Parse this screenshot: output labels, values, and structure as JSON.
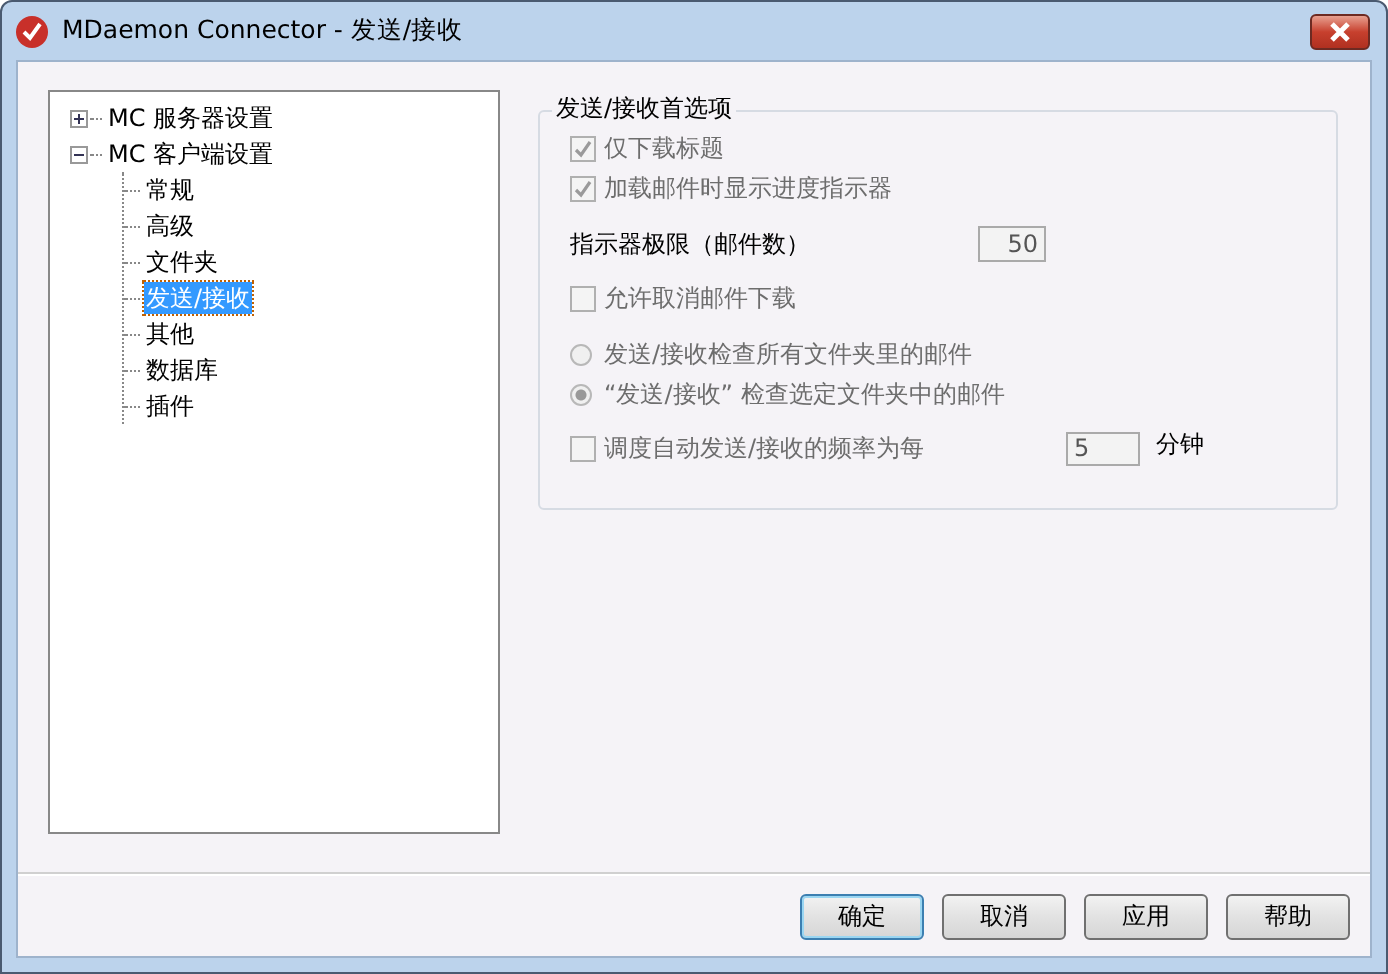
{
  "window": {
    "title": "MDaemon Connector - 发送/接收"
  },
  "tree": [
    {
      "label": "MC 服务器设置",
      "expanded": false,
      "selected": false
    },
    {
      "label": "MC 客户端设置",
      "expanded": true,
      "selected": false,
      "children": [
        {
          "label": "常规",
          "selected": false
        },
        {
          "label": "高级",
          "selected": false
        },
        {
          "label": "文件夹",
          "selected": false
        },
        {
          "label": "发送/接收",
          "selected": true
        },
        {
          "label": "其他",
          "selected": false
        },
        {
          "label": "数据库",
          "selected": false
        },
        {
          "label": "插件",
          "selected": false
        }
      ]
    }
  ],
  "group": {
    "title": "发送/接收首选项",
    "options": [
      {
        "kind": "checkbox",
        "label": "仅下载标题",
        "checked": true,
        "disabled": true
      },
      {
        "kind": "checkbox",
        "label": "加载邮件时显示进度指示器",
        "checked": true,
        "disabled": true
      },
      {
        "kind": "number",
        "label": "指示器极限（邮件数）",
        "value": "50",
        "disabled": true
      },
      {
        "kind": "checkbox",
        "label": "允许取消邮件下载",
        "checked": false,
        "disabled": true
      },
      {
        "kind": "radio",
        "label": "发送/接收检查所有文件夹里的邮件",
        "selected": false,
        "disabled": true
      },
      {
        "kind": "radio",
        "label": "“发送/接收” 检查选定文件夹中的邮件",
        "selected": true,
        "disabled": true
      },
      {
        "kind": "schedule",
        "label": "调度自动发送/接收的频率为每",
        "checked": false,
        "value": "5",
        "unit": "分钟",
        "disabled": true
      }
    ]
  },
  "buttons": [
    {
      "label": "确定",
      "default": true
    },
    {
      "label": "取消",
      "default": false
    },
    {
      "label": "应用",
      "default": false
    },
    {
      "label": "帮助",
      "default": false
    }
  ]
}
